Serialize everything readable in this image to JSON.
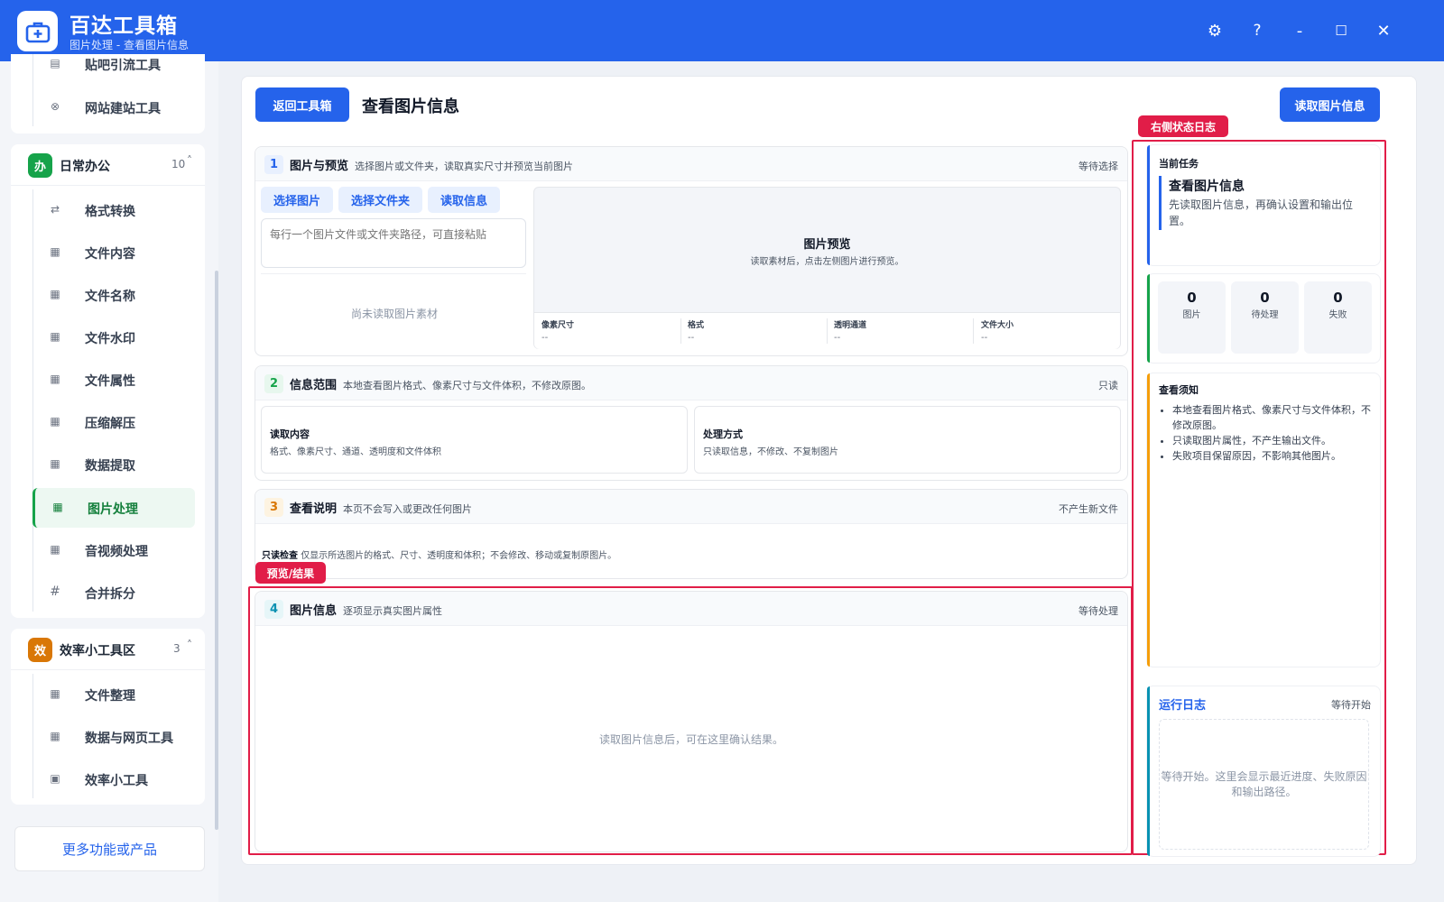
{
  "app": {
    "title": "百达工具箱",
    "subtitle": "图片处理 - 查看图片信息"
  },
  "window_controls": {
    "settings": "⚙",
    "help": "?",
    "minimize": "-",
    "maximize": "☐",
    "close": "✕"
  },
  "sidebar": {
    "top_items": [
      {
        "label": "贴吧引流工具",
        "icon": "doc-icon"
      },
      {
        "label": "网站建站工具",
        "icon": "globe-icon"
      }
    ],
    "groups": [
      {
        "badge": "办",
        "title": "日常办公",
        "count": "10",
        "color": "#16a34a",
        "items": [
          {
            "label": "格式转换",
            "icon": "swap-icon"
          },
          {
            "label": "文件内容",
            "icon": "grid-icon"
          },
          {
            "label": "文件名称",
            "icon": "grid-icon"
          },
          {
            "label": "文件水印",
            "icon": "grid-icon"
          },
          {
            "label": "文件属性",
            "icon": "grid-icon"
          },
          {
            "label": "压缩解压",
            "icon": "grid-icon"
          },
          {
            "label": "数据提取",
            "icon": "grid-icon"
          },
          {
            "label": "图片处理",
            "icon": "grid-icon",
            "active": true
          },
          {
            "label": "音视频处理",
            "icon": "grid-icon"
          },
          {
            "label": "合并拆分",
            "icon": "hash-icon"
          }
        ]
      },
      {
        "badge": "效",
        "title": "效率小工具区",
        "count": "3",
        "color": "#d97706",
        "items": [
          {
            "label": "文件整理",
            "icon": "grid-icon"
          },
          {
            "label": "数据与网页工具",
            "icon": "grid-icon"
          },
          {
            "label": "效率小工具",
            "icon": "box-icon"
          }
        ]
      }
    ],
    "more_label": "更多功能或产品"
  },
  "header": {
    "back_label": "返回工具箱",
    "page_title": "查看图片信息",
    "read_label": "读取图片信息"
  },
  "sections": {
    "s1": {
      "num": "1",
      "title": "图片与预览",
      "desc": "选择图片或文件夹，读取真实尺寸并预览当前图片",
      "status": "等待选择",
      "buttons": {
        "pick_image": "选择图片",
        "pick_folder": "选择文件夹",
        "read_info": "读取信息"
      },
      "path_placeholder": "每行一个图片文件或文件夹路径，可直接粘贴",
      "empty": "尚未读取图片素材",
      "preview_title": "图片预览",
      "preview_hint": "读取素材后，点击左侧图片进行预览。",
      "info": [
        {
          "label": "像素尺寸",
          "value": "--"
        },
        {
          "label": "格式",
          "value": "--"
        },
        {
          "label": "透明通道",
          "value": "--"
        },
        {
          "label": "文件大小",
          "value": "--"
        }
      ]
    },
    "s2": {
      "num": "2",
      "title": "信息范围",
      "desc": "本地查看图片格式、像素尺寸与文件体积，不修改原图。",
      "status": "只读",
      "boxes": [
        {
          "title": "读取内容",
          "desc": "格式、像素尺寸、通道、透明度和文件体积"
        },
        {
          "title": "处理方式",
          "desc": "只读取信息，不修改、不复制图片"
        }
      ]
    },
    "s3": {
      "num": "3",
      "title": "查看说明",
      "desc": "本页不会写入或更改任何图片",
      "status": "不产生新文件",
      "body_strong": "只读检查",
      "body": "仅显示所选图片的格式、尺寸、透明度和体积；不会修改、移动或复制原图片。"
    },
    "s4": {
      "num": "4",
      "title": "图片信息",
      "desc": "逐项显示真实图片属性",
      "status": "等待处理",
      "empty": "读取图片信息后，可在这里确认结果。"
    }
  },
  "annotations": {
    "right_log": "右侧状态日志",
    "preview_result": "预览/结果"
  },
  "right": {
    "task": {
      "label": "当前任务",
      "title": "查看图片信息",
      "desc": "先读取图片信息，再确认设置和输出位置。"
    },
    "stats": [
      {
        "value": "0",
        "label": "图片"
      },
      {
        "value": "0",
        "label": "待处理"
      },
      {
        "value": "0",
        "label": "失败"
      }
    ],
    "notes": {
      "title": "查看须知",
      "items": [
        "本地查看图片格式、像素尺寸与文件体积，不修改原图。",
        "只读取图片属性，不产生输出文件。",
        "失败项目保留原因，不影响其他图片。"
      ]
    },
    "log": {
      "title": "运行日志",
      "status": "等待开始",
      "empty": "等待开始。这里会显示最近进度、失败原因和输出路径。"
    }
  },
  "colors": {
    "brand": "#2563eb",
    "accent_green": "#16a34a",
    "annotation": "#e11d48"
  }
}
